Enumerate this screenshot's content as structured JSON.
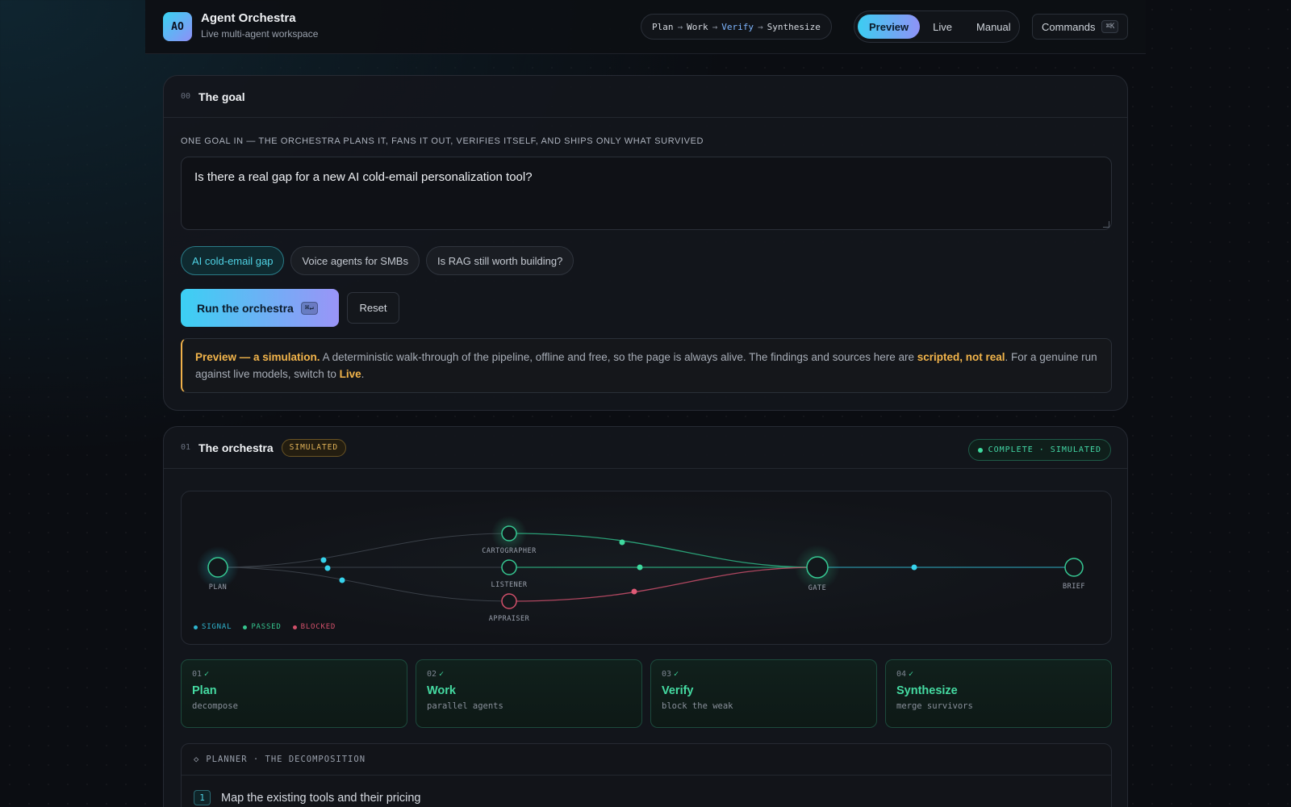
{
  "app": {
    "logo_text": "AO",
    "title": "Agent Orchestra",
    "subtitle": "Live multi-agent workspace"
  },
  "pipeline": {
    "steps": [
      "Plan",
      "Work",
      "Verify",
      "Synthesize"
    ],
    "arrow": "→",
    "highlight": "Verify"
  },
  "modes": {
    "items": [
      "Preview",
      "Live",
      "Manual"
    ],
    "active": "Preview"
  },
  "commands": {
    "label": "Commands",
    "shortcut": "⌘K"
  },
  "goal_section": {
    "num": "00",
    "title": "The goal",
    "caption": "ONE GOAL IN — THE ORCHESTRA PLANS IT, FANS IT OUT, VERIFIES ITSELF, AND SHIPS ONLY WHAT SURVIVED",
    "input_value": "Is there a real gap for a new AI cold-email personalization tool?",
    "chips": [
      "AI cold-email gap",
      "Voice agents for SMBs",
      "Is RAG still worth building?"
    ],
    "active_chip": "AI cold-email gap",
    "run_label": "Run the orchestra",
    "run_shortcut": "⌘↵",
    "reset_label": "Reset",
    "notice": {
      "lead": "Preview — a simulation.",
      "text1": " A deterministic walk-through of the pipeline, offline and free, so the page is always alive. The findings and sources here are ",
      "emph": "scripted, not real",
      "text2": ". For a genuine run against live models, switch to ",
      "live": "Live",
      "text3": "."
    }
  },
  "orchestra_section": {
    "num": "01",
    "title": "The orchestra",
    "badge": "SIMULATED",
    "status": "COMPLETE · SIMULATED",
    "nodes": {
      "plan": "PLAN",
      "cartographer": "CARTOGRAPHER",
      "listener": "LISTENER",
      "appraiser": "APPRAISER",
      "gate": "GATE",
      "brief": "BRIEF"
    },
    "legend": [
      {
        "label": "SIGNAL",
        "color": "#2fb5cf"
      },
      {
        "label": "PASSED",
        "color": "#35c58e"
      },
      {
        "label": "BLOCKED",
        "color": "#d2506a"
      }
    ],
    "stages": [
      {
        "num": "01",
        "check": "✓",
        "name": "Plan",
        "desc": "decompose"
      },
      {
        "num": "02",
        "check": "✓",
        "name": "Work",
        "desc": "parallel agents"
      },
      {
        "num": "03",
        "check": "✓",
        "name": "Verify",
        "desc": "block the weak"
      },
      {
        "num": "04",
        "check": "✓",
        "name": "Synthesize",
        "desc": "merge survivors"
      }
    ],
    "planner": {
      "icon": "◇",
      "title": "PLANNER · THE DECOMPOSITION",
      "items": [
        {
          "num": "1",
          "text": "Map the existing tools and their pricing"
        }
      ]
    }
  },
  "colors": {
    "accent_cyan": "#3bd0f3",
    "accent_violet": "#9a94f7",
    "passed": "#45dba2",
    "blocked": "#d2506a",
    "warn": "#f3b54b"
  }
}
